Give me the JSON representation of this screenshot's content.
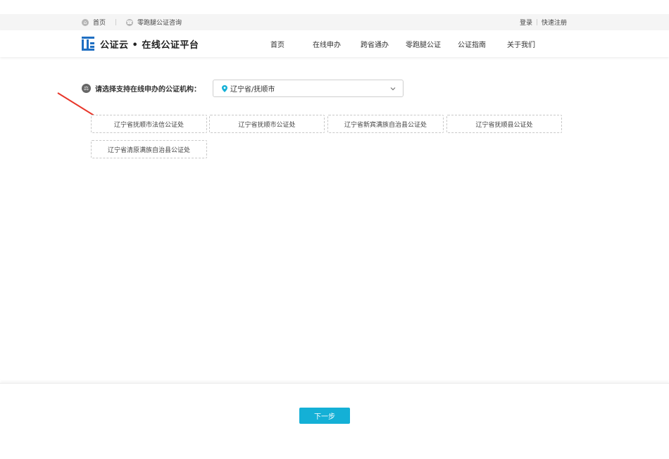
{
  "topbar": {
    "home_label": "首页",
    "consult_label": "零跑腿公证咨询",
    "login_label": "登录",
    "register_label": "快速注册"
  },
  "header": {
    "brand": "公证云 • 在线公证平台",
    "nav": [
      "首页",
      "在线申办",
      "跨省通办",
      "零跑腿公证",
      "公证指南",
      "关于我们"
    ]
  },
  "selector": {
    "prompt": "请选择支持在线申办的公证机构：",
    "value": "辽宁省/抚顺市"
  },
  "offices": [
    "辽宁省抚顺市法信公证处",
    "辽宁省抚顺市公证处",
    "辽宁省新宾满族自治县公证处",
    "辽宁省抚顺县公证处",
    "辽宁省清原满族自治县公证处"
  ],
  "footer": {
    "next_label": "下一步"
  },
  "colors": {
    "accent": "#14b0d6",
    "brand": "#1f6fc2",
    "arrow": "#e8362a"
  }
}
